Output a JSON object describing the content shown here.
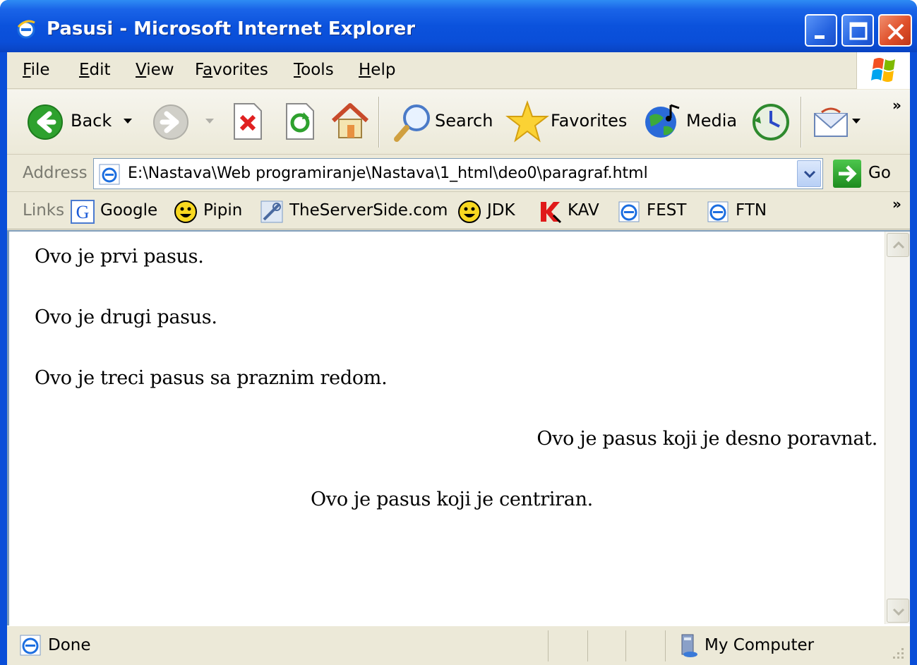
{
  "window": {
    "title": "Pasusi - Microsoft Internet Explorer",
    "colors": {
      "titlebar": "#0a4ed8",
      "close": "#e0502a",
      "chrome": "#ece9d8"
    }
  },
  "menu": {
    "file": {
      "first": "F",
      "rest": "ile"
    },
    "edit": {
      "first": "E",
      "rest": "dit"
    },
    "view": {
      "first": "V",
      "rest": "iew"
    },
    "favorites": {
      "pre": "F",
      "accel": "a",
      "rest": "vorites"
    },
    "tools": {
      "first": "T",
      "rest": "ools"
    },
    "help": {
      "first": "H",
      "rest": "elp"
    }
  },
  "toolbar": {
    "back_label": "Back",
    "search_label": "Search",
    "favorites_label": "Favorites",
    "media_label": "Media",
    "chevron": "»"
  },
  "address": {
    "label": "Address",
    "value": "E:\\Nastava\\Web programiranje\\Nastava\\1_html\\deo0\\paragraf.html",
    "go_label": "Go"
  },
  "links": {
    "label": "Links",
    "items": [
      "Google",
      "Pipin",
      "TheServerSide.com",
      "JDK",
      "KAV",
      "FEST",
      "FTN"
    ],
    "chevron": "»"
  },
  "page": {
    "paragraphs": [
      "Ovo je prvi pasus.",
      "Ovo je drugi pasus.",
      "Ovo je treci pasus sa praznim redom.",
      "Ovo je pasus koji je desno poravnat.",
      "Ovo je pasus koji je centriran."
    ]
  },
  "status": {
    "text": "Done",
    "zone": "My Computer"
  }
}
